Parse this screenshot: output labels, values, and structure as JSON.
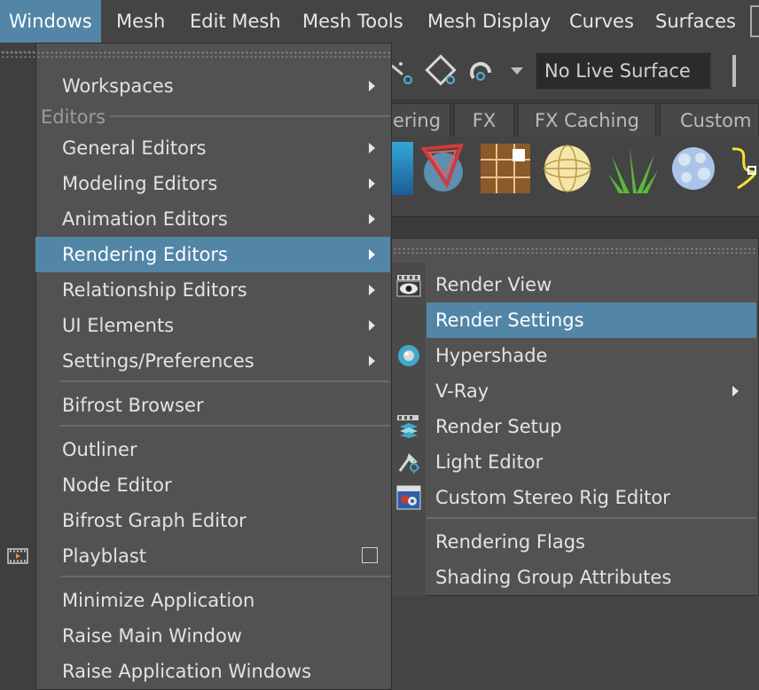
{
  "menubar": {
    "items": [
      "Windows",
      "Mesh",
      "Edit Mesh",
      "Mesh Tools",
      "Mesh Display",
      "Curves",
      "Surfaces"
    ]
  },
  "toolbar": {
    "live_surface": "No Live Surface"
  },
  "shelf": {
    "tabs": [
      "ering",
      "FX",
      "FX Caching",
      "Custom"
    ]
  },
  "windows_menu": {
    "items": {
      "workspaces": "Workspaces",
      "editors_header": "Editors",
      "general_editors": "General Editors",
      "modeling_editors": "Modeling Editors",
      "animation_editors": "Animation Editors",
      "rendering_editors": "Rendering Editors",
      "relationship_editors": "Relationship Editors",
      "ui_elements": "UI Elements",
      "settings_preferences": "Settings/Preferences",
      "bifrost_browser": "Bifrost Browser",
      "outliner": "Outliner",
      "node_editor": "Node Editor",
      "bifrost_graph_editor": "Bifrost Graph Editor",
      "playblast": "Playblast",
      "minimize_application": "Minimize Application",
      "raise_main_window": "Raise Main Window",
      "raise_application_windows": "Raise Application Windows"
    }
  },
  "rendering_submenu": {
    "items": {
      "render_view": "Render View",
      "render_settings": "Render Settings",
      "hypershade": "Hypershade",
      "vray": "V-Ray",
      "render_setup": "Render Setup",
      "light_editor": "Light Editor",
      "custom_stereo_rig_editor": "Custom Stereo Rig Editor",
      "rendering_flags": "Rendering Flags",
      "shading_group_attributes": "Shading Group Attributes"
    }
  },
  "colors": {
    "highlight": "#5285a6",
    "menu_bg": "#525252",
    "app_bg": "#444444"
  }
}
